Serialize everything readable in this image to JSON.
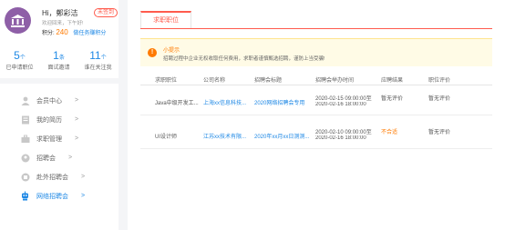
{
  "profile": {
    "greeting": "Hi，鄭彩洁",
    "badge": "未签到",
    "welcome": "欢迎回来，下午好!",
    "points_label": "积分:",
    "points_value": "240",
    "points_link": "做任务赚积分"
  },
  "stats": [
    {
      "value": "5",
      "unit": "个",
      "label": "已申请职位"
    },
    {
      "value": "1",
      "unit": "条",
      "label": "面试邀请"
    },
    {
      "value": "11",
      "unit": "个",
      "label": "谁在关注我"
    }
  ],
  "menu": [
    {
      "label": "会员中心",
      "icon": "person-icon",
      "active": false
    },
    {
      "label": "我的简历",
      "icon": "resume-icon",
      "active": false
    },
    {
      "label": "求职管理",
      "icon": "briefcase-icon",
      "active": false
    },
    {
      "label": "招聘会",
      "icon": "fair-icon",
      "active": false
    },
    {
      "label": "赴外招聘会",
      "icon": "outbound-fair-icon",
      "active": false
    },
    {
      "label": "网络招聘会",
      "icon": "robot-icon",
      "active": true
    }
  ],
  "menu_arrow": ">",
  "tab": "求职职位",
  "notice": {
    "title": "小提示",
    "text": "招聘过程中企业无权收取任何费用，求职者谨慎甄选招聘，谨防上当受骗!"
  },
  "table": {
    "headers": [
      "求职职位",
      "公司名称",
      "招聘会标题",
      "招聘会举办时间",
      "应聘结果",
      "职位评价"
    ],
    "rows": [
      {
        "position": "Java中级开发工...",
        "company": "上海xx信息科技...",
        "fair": "2020网络招聘会专用",
        "time1": "2020-02-15 09:00:00至",
        "time2": "2020-02-16 18:00:00",
        "result": "暂无评价",
        "eval": "暂无评价"
      },
      {
        "position": "UI设计师",
        "company": "江苏xx技术有限...",
        "fair": "2020年xx月xx日测测...",
        "time1": "2020-02-10 09:00:00至",
        "time2": "2020-02-16 18:00:00",
        "result": "不合适",
        "eval": "暂无评价"
      }
    ]
  },
  "colors": {
    "accent": "#ff5b4d",
    "link": "#1e88e5",
    "avatar": "#8e5fa7",
    "orange": "#ff7a00"
  }
}
